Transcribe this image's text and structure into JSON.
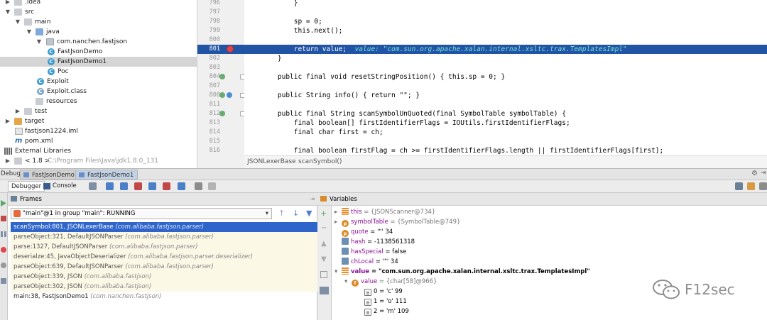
{
  "project_tree": [
    {
      "label": ".idea",
      "kind": "folder",
      "state": "collapsed"
    },
    {
      "label": "src",
      "kind": "folder",
      "state": "expanded"
    },
    {
      "label": "main",
      "kind": "folder",
      "state": "expanded"
    },
    {
      "label": "java",
      "kind": "src-folder",
      "state": "expanded"
    },
    {
      "label": "com.nanchen.fastjson",
      "kind": "package",
      "state": "expanded"
    },
    {
      "label": "FastJsonDemo",
      "kind": "class"
    },
    {
      "label": "FastJsonDemo1",
      "kind": "class",
      "selected": true
    },
    {
      "label": "Poc",
      "kind": "class"
    },
    {
      "label": "Exploit",
      "kind": "class"
    },
    {
      "label": "Exploit.class",
      "kind": "class-file"
    },
    {
      "label": "resources",
      "kind": "folder"
    },
    {
      "label": "test",
      "kind": "folder",
      "state": "collapsed"
    },
    {
      "label": "target",
      "kind": "orange-folder",
      "state": "collapsed"
    },
    {
      "label": "fastjson1224.iml",
      "kind": "file"
    },
    {
      "label": "pom.xml",
      "kind": "maven"
    },
    {
      "label": "External Libraries",
      "kind": "libraries",
      "state": "expanded"
    },
    {
      "label": "< 1.8 >",
      "kind": "jdk",
      "state": "collapsed",
      "path": "C:\\Program Files\\Java\\jdk1.8.0_131"
    }
  ],
  "editor": {
    "lines": [
      {
        "n": "796",
        "code": "        }"
      },
      {
        "n": "797",
        "code": ""
      },
      {
        "n": "798",
        "code": "        sp = 0;"
      },
      {
        "n": "799",
        "code": "        this.next();"
      },
      {
        "n": "800",
        "code": ""
      },
      {
        "n": "801",
        "code": "        return value;",
        "inline_value": "value: \"com.sun.org.apache.xalan.internal.xsltc.trax.TemplatesImpl\"",
        "highlighted": true
      },
      {
        "n": "802",
        "code": "    }"
      },
      {
        "n": "803",
        "code": ""
      },
      {
        "n": "804",
        "code": "    public final void resetStringPosition() { this.sp = 0; }"
      },
      {
        "n": "807",
        "code": ""
      },
      {
        "n": "808",
        "code": "    public String info() { return \"\"; }"
      },
      {
        "n": "811",
        "code": ""
      },
      {
        "n": "812",
        "code": "    public final String scanSymbolUnQuoted(final SymbolTable symbolTable) {"
      },
      {
        "n": "813",
        "code": "        final boolean[] firstIdentifierFlags = IOUtils.firstIdentifierFlags;"
      },
      {
        "n": "814",
        "code": "        final char first = ch;"
      },
      {
        "n": "815",
        "code": ""
      },
      {
        "n": "816",
        "code": "        final boolean firstFlag = ch >= firstIdentifierFlags.length || firstIdentifierFlags[first];"
      }
    ],
    "breadcrumb": [
      "JSONLexerBase",
      "scanSymbol()"
    ]
  },
  "debug": {
    "label": "Debug:",
    "tabs": [
      "FastJsonDemo1",
      "FastJsonDemo1"
    ],
    "toolbar_tabs": [
      "Debugger",
      "Console"
    ],
    "frames_title": "Frames",
    "variables_title": "Variables",
    "thread": "\"main\"@1 in group \"main\": RUNNING",
    "frames": [
      {
        "method": "scanSymbol:801, JSONLexerBase",
        "pkg": "(com.alibaba.fastjson.parser)",
        "selected": true,
        "library": true
      },
      {
        "method": "parseObject:321, DefaultJSONParser",
        "pkg": "(com.alibaba.fastjson.parser)",
        "library": true
      },
      {
        "method": "parse:1327, DefaultJSONParser",
        "pkg": "(com.alibaba.fastjson.parser)",
        "library": true
      },
      {
        "method": "deserialze:45, JavaObjectDeserializer",
        "pkg": "(com.alibaba.fastjson.parser.deserializer)",
        "library": true
      },
      {
        "method": "parseObject:639, DefaultJSONParser",
        "pkg": "(com.alibaba.fastjson.parser)",
        "library": true
      },
      {
        "method": "parseObject:339, JSON",
        "pkg": "(com.alibaba.fastjson)",
        "library": true
      },
      {
        "method": "parseObject:302, JSON",
        "pkg": "(com.alibaba.fastjson)",
        "library": true
      },
      {
        "method": "main:38, FastJsonDemo1",
        "pkg": "(com.nanchen.fastjson)",
        "library": false
      }
    ],
    "variables": [
      {
        "expand": "▸",
        "icon": "bars",
        "name": "this",
        "value": " = {JSONScanner@734}",
        "indent": 0
      },
      {
        "expand": "▸",
        "icon": "p",
        "name": "symbolTable",
        "value": " = {SymbolTable@749}",
        "indent": 0
      },
      {
        "expand": "",
        "icon": "p",
        "name": "quote",
        "value": " = '\"' 34",
        "indent": 0
      },
      {
        "expand": "",
        "icon": "sq",
        "name": "hash",
        "value": " = -1138561318",
        "indent": 0
      },
      {
        "expand": "",
        "icon": "sq",
        "name": "hasSpecial",
        "value": " = false",
        "indent": 0
      },
      {
        "expand": "",
        "icon": "sq",
        "name": "chLocal",
        "value": " = '\"' 34",
        "indent": 0
      },
      {
        "expand": "▾",
        "icon": "bars",
        "name": "value",
        "value": " = \"com.sun.org.apache.xalan.internal.xsltc.trax.TemplatesImpl\"",
        "indent": 0,
        "bold": true
      },
      {
        "expand": "▾",
        "icon": "f",
        "name": "value",
        "value": " = {char[58]@966}",
        "indent": 1
      },
      {
        "expand": "",
        "icon": "arr",
        "name": "0",
        "value": " = 'c' 99",
        "indent": 2
      },
      {
        "expand": "",
        "icon": "arr",
        "name": "1",
        "value": " = 'o' 111",
        "indent": 2
      },
      {
        "expand": "",
        "icon": "arr",
        "name": "2",
        "value": " = 'm' 109",
        "indent": 2
      }
    ]
  },
  "watermark": "F12sec",
  "colors": {
    "highlight": "#2154a5",
    "frame_selected": "#2f65ca",
    "library_frame": "#fbf8e6",
    "breakpoint": "#e0454b"
  }
}
